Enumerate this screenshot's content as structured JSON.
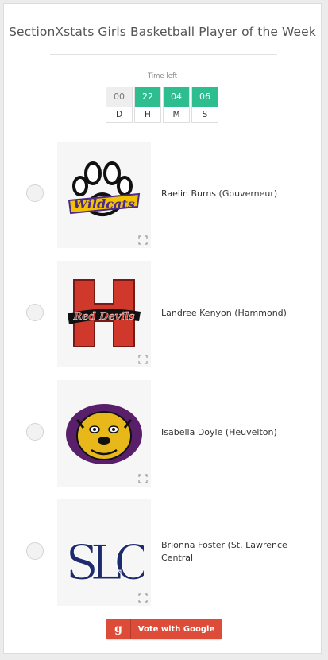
{
  "poll": {
    "title": "SectionXstats Girls Basketball Player of the Week",
    "time_left_label": "Time left"
  },
  "countdown": [
    {
      "value": "00",
      "unit": "D",
      "style": "grey"
    },
    {
      "value": "22",
      "unit": "H",
      "style": "green"
    },
    {
      "value": "04",
      "unit": "M",
      "style": "green"
    },
    {
      "value": "06",
      "unit": "S",
      "style": "green"
    }
  ],
  "options": [
    {
      "name": "Raelin Burns (Gouverneur)",
      "logo": "wildcats-paw-logo",
      "logo_text": "Wildcats"
    },
    {
      "name": "Landree Kenyon (Hammond)",
      "logo": "red-devils-h-logo",
      "logo_text": "Red Devils"
    },
    {
      "name": "Isabella Doyle (Heuvelton)",
      "logo": "bulldog-logo"
    },
    {
      "name": "Brionna Foster (St. Lawrence Central",
      "logo": "slc-monogram-logo",
      "logo_text": "SLC"
    }
  ],
  "vote_button": {
    "icon": "google-g-icon",
    "icon_glyph": "g",
    "label": "Vote with Google"
  },
  "colors": {
    "timer_green": "#2ebd8f",
    "vote_red": "#dd4b39",
    "wildcats_gold": "#f2c200",
    "wildcats_purple": "#4a2a8a",
    "red_devils_red": "#d0382b",
    "bulldog_purple": "#5a1f6b",
    "slc_navy": "#1c2a6e"
  }
}
